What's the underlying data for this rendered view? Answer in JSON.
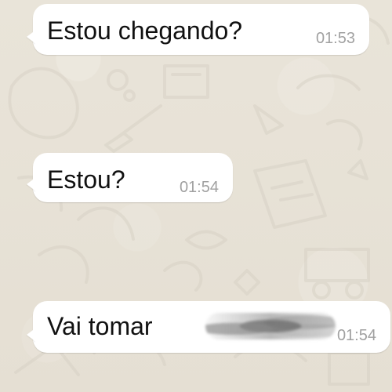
{
  "chat": {
    "messages": [
      {
        "text": "Estou chegando?",
        "time": "01:53",
        "direction": "incoming"
      },
      {
        "text": "Estou?",
        "time": "01:54",
        "direction": "incoming"
      },
      {
        "text": "Vai tomar",
        "time": "01:54",
        "direction": "incoming",
        "redacted": true
      }
    ]
  },
  "colors": {
    "background": "#e8e3d8",
    "bubble": "#ffffff",
    "text": "#111111",
    "timestamp": "#a1a1a1"
  },
  "icons": [
    "chat-wallpaper-doodles",
    "blurred-redaction"
  ]
}
